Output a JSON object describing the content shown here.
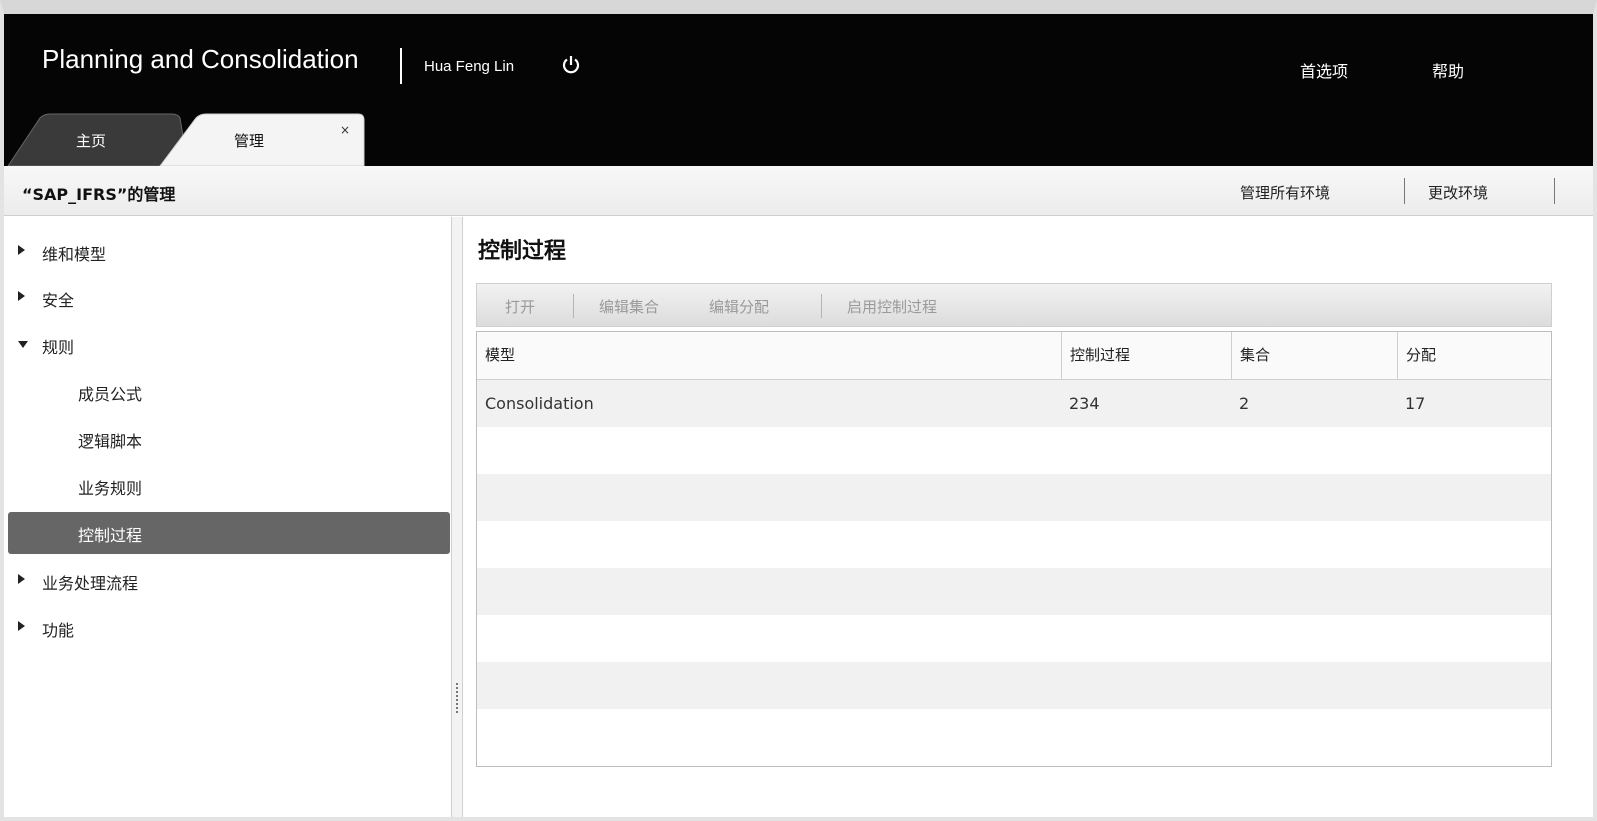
{
  "header": {
    "app_title": "Planning and Consolidation",
    "user_name": "Hua Feng Lin",
    "preferences_label": "首选项",
    "help_label": "帮助"
  },
  "tabs": [
    {
      "label": "主页",
      "active": false
    },
    {
      "label": "管理",
      "active": true
    }
  ],
  "tab_close_glyph": "×",
  "subheader": {
    "title": "“SAP_IFRS”的管理",
    "link_manage_all": "管理所有环境",
    "link_change_env": "更改环境"
  },
  "nav": {
    "items": [
      {
        "label": "维和模型",
        "expanded": false
      },
      {
        "label": "安全",
        "expanded": false
      },
      {
        "label": "规则",
        "expanded": true
      },
      {
        "label": "成员公式",
        "sub": true
      },
      {
        "label": "逻辑脚本",
        "sub": true
      },
      {
        "label": "业务规则",
        "sub": true
      },
      {
        "label": "控制过程",
        "sub": true,
        "selected": true
      },
      {
        "label": "业务处理流程",
        "expanded": false
      },
      {
        "label": "功能",
        "expanded": false
      }
    ]
  },
  "main": {
    "title": "控制过程",
    "toolbar": {
      "open": "打开",
      "edit_sets": "编辑集合",
      "edit_assign": "编辑分配",
      "enable": "启用控制过程"
    },
    "columns": [
      "模型",
      "控制过程",
      "集合",
      "分配"
    ],
    "rows": [
      [
        "Consolidation",
        "234",
        "2",
        "17"
      ]
    ]
  },
  "colors": {
    "header_bg": "#050505",
    "selected_nav_bg": "#666666",
    "row_alt": "#f1f1f1"
  },
  "icons": {
    "power": "power-icon",
    "expand": "triangle-right-icon",
    "collapse": "triangle-down-icon"
  }
}
